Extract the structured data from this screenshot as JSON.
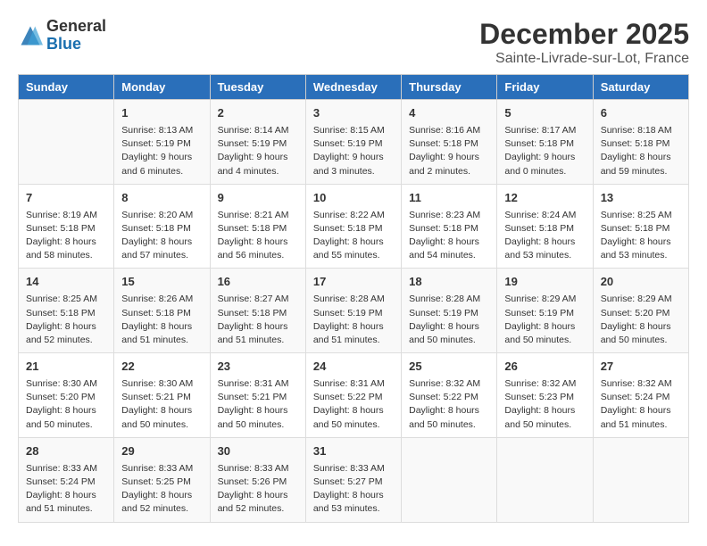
{
  "logo": {
    "general": "General",
    "blue": "Blue"
  },
  "title": "December 2025",
  "subtitle": "Sainte-Livrade-sur-Lot, France",
  "columns": [
    "Sunday",
    "Monday",
    "Tuesday",
    "Wednesday",
    "Thursday",
    "Friday",
    "Saturday"
  ],
  "weeks": [
    [
      {
        "day": "",
        "info": ""
      },
      {
        "day": "1",
        "info": "Sunrise: 8:13 AM\nSunset: 5:19 PM\nDaylight: 9 hours\nand 6 minutes."
      },
      {
        "day": "2",
        "info": "Sunrise: 8:14 AM\nSunset: 5:19 PM\nDaylight: 9 hours\nand 4 minutes."
      },
      {
        "day": "3",
        "info": "Sunrise: 8:15 AM\nSunset: 5:19 PM\nDaylight: 9 hours\nand 3 minutes."
      },
      {
        "day": "4",
        "info": "Sunrise: 8:16 AM\nSunset: 5:18 PM\nDaylight: 9 hours\nand 2 minutes."
      },
      {
        "day": "5",
        "info": "Sunrise: 8:17 AM\nSunset: 5:18 PM\nDaylight: 9 hours\nand 0 minutes."
      },
      {
        "day": "6",
        "info": "Sunrise: 8:18 AM\nSunset: 5:18 PM\nDaylight: 8 hours\nand 59 minutes."
      }
    ],
    [
      {
        "day": "7",
        "info": "Sunrise: 8:19 AM\nSunset: 5:18 PM\nDaylight: 8 hours\nand 58 minutes."
      },
      {
        "day": "8",
        "info": "Sunrise: 8:20 AM\nSunset: 5:18 PM\nDaylight: 8 hours\nand 57 minutes."
      },
      {
        "day": "9",
        "info": "Sunrise: 8:21 AM\nSunset: 5:18 PM\nDaylight: 8 hours\nand 56 minutes."
      },
      {
        "day": "10",
        "info": "Sunrise: 8:22 AM\nSunset: 5:18 PM\nDaylight: 8 hours\nand 55 minutes."
      },
      {
        "day": "11",
        "info": "Sunrise: 8:23 AM\nSunset: 5:18 PM\nDaylight: 8 hours\nand 54 minutes."
      },
      {
        "day": "12",
        "info": "Sunrise: 8:24 AM\nSunset: 5:18 PM\nDaylight: 8 hours\nand 53 minutes."
      },
      {
        "day": "13",
        "info": "Sunrise: 8:25 AM\nSunset: 5:18 PM\nDaylight: 8 hours\nand 53 minutes."
      }
    ],
    [
      {
        "day": "14",
        "info": "Sunrise: 8:25 AM\nSunset: 5:18 PM\nDaylight: 8 hours\nand 52 minutes."
      },
      {
        "day": "15",
        "info": "Sunrise: 8:26 AM\nSunset: 5:18 PM\nDaylight: 8 hours\nand 51 minutes."
      },
      {
        "day": "16",
        "info": "Sunrise: 8:27 AM\nSunset: 5:18 PM\nDaylight: 8 hours\nand 51 minutes."
      },
      {
        "day": "17",
        "info": "Sunrise: 8:28 AM\nSunset: 5:19 PM\nDaylight: 8 hours\nand 51 minutes."
      },
      {
        "day": "18",
        "info": "Sunrise: 8:28 AM\nSunset: 5:19 PM\nDaylight: 8 hours\nand 50 minutes."
      },
      {
        "day": "19",
        "info": "Sunrise: 8:29 AM\nSunset: 5:19 PM\nDaylight: 8 hours\nand 50 minutes."
      },
      {
        "day": "20",
        "info": "Sunrise: 8:29 AM\nSunset: 5:20 PM\nDaylight: 8 hours\nand 50 minutes."
      }
    ],
    [
      {
        "day": "21",
        "info": "Sunrise: 8:30 AM\nSunset: 5:20 PM\nDaylight: 8 hours\nand 50 minutes."
      },
      {
        "day": "22",
        "info": "Sunrise: 8:30 AM\nSunset: 5:21 PM\nDaylight: 8 hours\nand 50 minutes."
      },
      {
        "day": "23",
        "info": "Sunrise: 8:31 AM\nSunset: 5:21 PM\nDaylight: 8 hours\nand 50 minutes."
      },
      {
        "day": "24",
        "info": "Sunrise: 8:31 AM\nSunset: 5:22 PM\nDaylight: 8 hours\nand 50 minutes."
      },
      {
        "day": "25",
        "info": "Sunrise: 8:32 AM\nSunset: 5:22 PM\nDaylight: 8 hours\nand 50 minutes."
      },
      {
        "day": "26",
        "info": "Sunrise: 8:32 AM\nSunset: 5:23 PM\nDaylight: 8 hours\nand 50 minutes."
      },
      {
        "day": "27",
        "info": "Sunrise: 8:32 AM\nSunset: 5:24 PM\nDaylight: 8 hours\nand 51 minutes."
      }
    ],
    [
      {
        "day": "28",
        "info": "Sunrise: 8:33 AM\nSunset: 5:24 PM\nDaylight: 8 hours\nand 51 minutes."
      },
      {
        "day": "29",
        "info": "Sunrise: 8:33 AM\nSunset: 5:25 PM\nDaylight: 8 hours\nand 52 minutes."
      },
      {
        "day": "30",
        "info": "Sunrise: 8:33 AM\nSunset: 5:26 PM\nDaylight: 8 hours\nand 52 minutes."
      },
      {
        "day": "31",
        "info": "Sunrise: 8:33 AM\nSunset: 5:27 PM\nDaylight: 8 hours\nand 53 minutes."
      },
      {
        "day": "",
        "info": ""
      },
      {
        "day": "",
        "info": ""
      },
      {
        "day": "",
        "info": ""
      }
    ]
  ]
}
